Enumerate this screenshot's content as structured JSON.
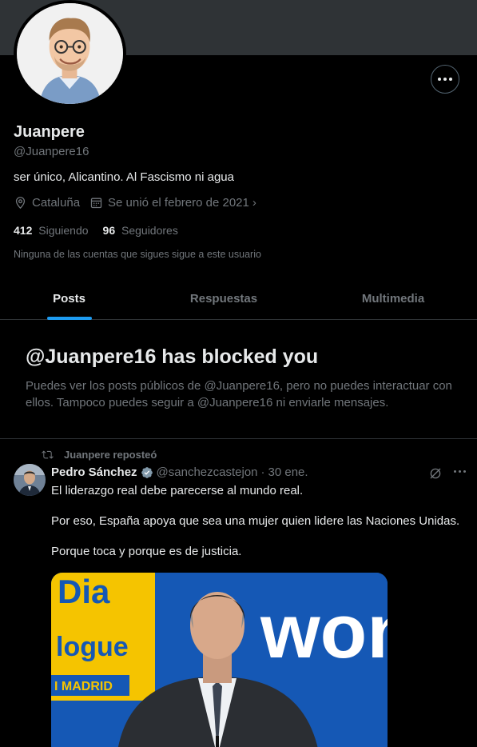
{
  "profile": {
    "name": "Juanpere",
    "handle": "@Juanpere16",
    "bio": "ser único, Alicantino. Al Fascismo ni agua",
    "location": "Cataluña",
    "joined": "Se unió el febrero de 2021",
    "following_count": "412",
    "following_label": "Siguiendo",
    "followers_count": "96",
    "followers_label": "Seguidores",
    "mutual_notice": "Ninguna de las cuentas que sigues sigue a este usuario"
  },
  "tabs": [
    {
      "label": "Posts",
      "active": true
    },
    {
      "label": "Respuestas",
      "active": false
    },
    {
      "label": "Multimedia",
      "active": false
    }
  ],
  "blocked": {
    "title": "@Juanpere16 has blocked you",
    "message": "Puedes ver los posts públicos de @Juanpere16, pero no puedes interactuar con ellos. Tampoco puedes seguir a @Juanpere16 ni enviarle mensajes."
  },
  "tweet": {
    "repost_label": "Juanpere reposteó",
    "author_name": "Pedro Sánchez",
    "author_handle": "@sanchezcastejon",
    "date": "30 ene.",
    "paragraphs": [
      "El liderazgo real debe parecerse al mundo real.",
      "Por eso, España apoya que sea una mujer quien lidere las Naciones Unidas.",
      "Porque toca y porque es de justicia."
    ],
    "media_text": {
      "left_top": "Dia",
      "left_mid": "logue",
      "left_city": "I MADRID",
      "right": "won"
    }
  },
  "colors": {
    "background": "#000000",
    "accent": "#1d9bf0",
    "text_primary": "#e7e9ea",
    "text_secondary": "#71767b",
    "border": "#2f3336",
    "banner": "#2f3336"
  },
  "icons": {
    "more": "more-horizontal-icon",
    "location": "location-pin-icon",
    "calendar": "calendar-icon",
    "repost": "repost-icon",
    "verified": "verified-badge-icon",
    "grok": "grok-icon"
  }
}
